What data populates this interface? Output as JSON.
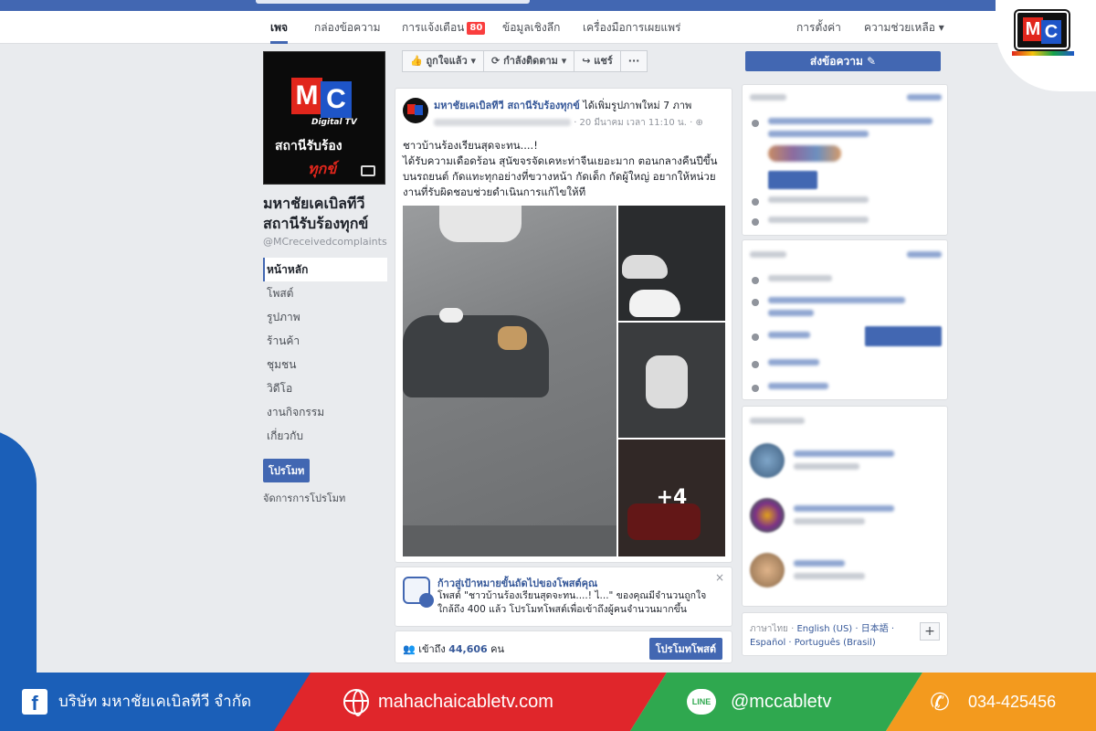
{
  "page_nav": {
    "tabs": [
      {
        "label": "เพจ"
      },
      {
        "label": "กล่องข้อความ"
      },
      {
        "label": "การแจ้งเตือน",
        "badge": "80"
      },
      {
        "label": "ข้อมูลเชิงลึก"
      },
      {
        "label": "เครื่องมือการเผยแพร่"
      }
    ],
    "settings": "การตั้งค่า",
    "help": "ความช่วยเหลือ ▾"
  },
  "profile": {
    "logo_m": "M",
    "logo_c": "C",
    "logo_sub": "Digital TV",
    "logo_line1": "สถานีรับร้อง",
    "logo_line2": "ทุกข์",
    "page_name": "มหาชัยเคเบิลทีวี สถานีรับร้องทุกข์",
    "handle": "@MCreceivedcomplaints"
  },
  "left_nav": {
    "items": [
      "หน้าหลัก",
      "โพสต์",
      "รูปภาพ",
      "ร้านค้า",
      "ชุมชน",
      "วิดีโอ",
      "งานกิจกรรม",
      "เกี่ยวกับ"
    ],
    "promote": "โปรโมท",
    "manage_promotions": "จัดการการโปรโมท"
  },
  "actions": {
    "like": "👍 ถูกใจแล้ว ▾",
    "follow": "⟳ กำลังติดตาม ▾",
    "share": "↪ แชร์",
    "more": "···",
    "send_message": "ส่งข้อความ ✎"
  },
  "post": {
    "page_name": "มหาชัยเคเบิลทีวี สถานีรับร้องทุกข์",
    "action": " ได้เพิ่มรูปภาพใหม่ 7 ภาพ",
    "timestamp": "· 20 มีนาคม เวลา 11:10 น. · ⊕",
    "text_line1": "ชาวบ้านร้องเรียนสุดจะทน....!",
    "text_body": "ได้รับความเดือดร้อน สุนัขจรจัดเคหะท่าจีนเยอะมาก ตอนกลางคืนปีขึ้นบนรถยนต์ กัดแทะทุกอย่างที่ขวางหน้า กัดเด็ก กัดผู้ใหญ่ อยากให้หน่วยงานที่รับผิดชอบช่วยดำเนินการแก้ไขให้ที",
    "more_photos": "+4"
  },
  "promo_tip": {
    "title": "ก้าวสู่เป้าหมายขั้นถัดไปของโพสต์คุณ",
    "text": "โพสต์ \"ชาวบ้านร้องเรียนสุดจะทน....! ไ...\" ของคุณมีจำนวนถูกใจใกล้ถึง 400 แล้ว โปรโมทโพสต์เพื่อเข้าถึงผู้คนจำนวนมากขึ้น",
    "close": "×"
  },
  "reach": {
    "prefix": "เข้าถึง",
    "count": "44,606",
    "suffix": "คน",
    "boost": "โปรโมทโพสต์"
  },
  "languages": {
    "current": "ภาษาไทย ·",
    "others": "English (US) · 日本語 · Español · Português (Brasil)",
    "add": "+"
  },
  "footer": {
    "company": "บริษัท มหาชัยเคเบิลทีวี จำกัด",
    "website": "mahachaicabletv.com",
    "line_id": "@mccabletv",
    "phone": "034-425456",
    "fb_icon": "f",
    "line_icon": "LINE",
    "phone_icon": "✆",
    "colors": {
      "blue": "#1b5fb8",
      "red": "#e0262b",
      "green": "#2fa84f",
      "orange": "#f39a1e"
    }
  },
  "corner_logo": {
    "m": "M",
    "c": "C"
  }
}
